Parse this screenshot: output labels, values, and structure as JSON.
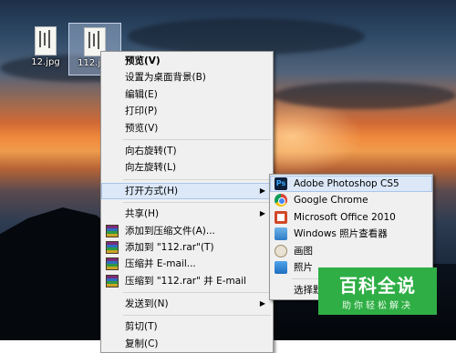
{
  "desktop": {
    "icons": [
      {
        "label": "12.jpg",
        "selected": false
      },
      {
        "label": "112.jpg",
        "selected": true
      }
    ]
  },
  "context_menu": {
    "items": [
      {
        "label": "预览(V)",
        "bold": true
      },
      {
        "label": "设置为桌面背景(B)"
      },
      {
        "label": "编辑(E)"
      },
      {
        "label": "打印(P)"
      },
      {
        "label": "预览(V)"
      },
      {
        "separator": true
      },
      {
        "label": "向右旋转(T)"
      },
      {
        "label": "向左旋转(L)"
      },
      {
        "separator": true
      },
      {
        "label": "打开方式(H)",
        "submenu": true,
        "highlighted": true
      },
      {
        "separator": true
      },
      {
        "label": "共享(H)",
        "submenu": true
      },
      {
        "label": "添加到压缩文件(A)...",
        "icon": "winrar-icon"
      },
      {
        "label": "添加到 \"112.rar\"(T)",
        "icon": "winrar-icon"
      },
      {
        "label": "压缩并 E-mail...",
        "icon": "winrar-icon"
      },
      {
        "label": "压缩到 \"112.rar\" 并 E-mail",
        "icon": "winrar-icon"
      },
      {
        "separator": true
      },
      {
        "label": "发送到(N)",
        "submenu": true
      },
      {
        "separator": true
      },
      {
        "label": "剪切(T)"
      },
      {
        "label": "复制(C)"
      }
    ]
  },
  "open_with_submenu": {
    "items": [
      {
        "label": "Adobe Photoshop CS5",
        "icon": "photoshop-icon",
        "highlighted": true
      },
      {
        "label": "Google Chrome",
        "icon": "chrome-icon"
      },
      {
        "label": "Microsoft Office 2010",
        "icon": "office-icon"
      },
      {
        "label": "Windows 照片查看器",
        "icon": "photo-viewer-icon"
      },
      {
        "label": "画图",
        "icon": "paint-icon"
      },
      {
        "label": "照片",
        "icon": "photos-icon"
      },
      {
        "separator": true
      },
      {
        "label": "选择默认程序(C)..."
      }
    ]
  },
  "watermark": {
    "title": "百科全说",
    "subtitle": "助你轻松解决",
    "color": "#2fae45"
  },
  "colors": {
    "menu_bg": "#f0f0f0",
    "highlight": "#dce8f8"
  }
}
